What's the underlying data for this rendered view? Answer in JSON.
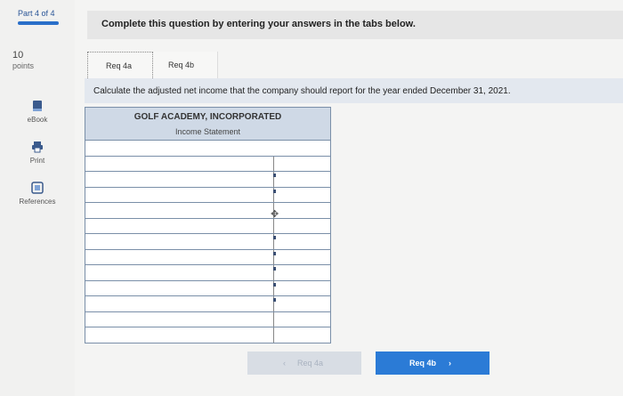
{
  "sidebar": {
    "part": "Part 4 of 4",
    "points_value": "10",
    "points_label": "points",
    "tools": [
      {
        "label": "eBook",
        "icon": "book-icon"
      },
      {
        "label": "Print",
        "icon": "printer-icon"
      },
      {
        "label": "References",
        "icon": "references-icon"
      }
    ]
  },
  "banner": "Complete this question by entering your answers in the tabs below.",
  "tabs": [
    "Req 4a",
    "Req 4b"
  ],
  "instruction": "Calculate the adjusted net income that the company should report for the year ended December 31, 2021.",
  "statement": {
    "company": "GOLF ACADEMY, INCORPORATED",
    "title": "Income Statement"
  },
  "nav": {
    "prev": "Req 4a",
    "next": "Req 4b"
  },
  "colors": {
    "accent": "#2b7bd6",
    "header": "#cfd9e6"
  }
}
